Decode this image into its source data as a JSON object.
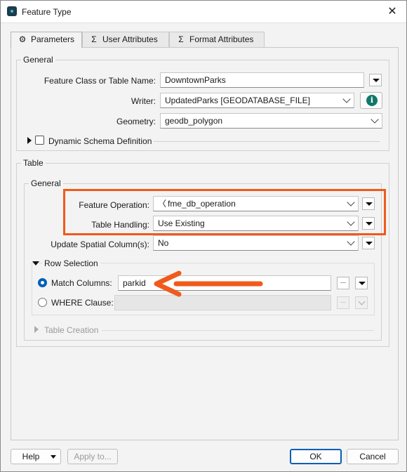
{
  "window": {
    "title": "Feature Type",
    "close_glyph": "✕"
  },
  "tabs": [
    {
      "label": "Parameters",
      "icon": "gear-icon",
      "active": true
    },
    {
      "label": "User Attributes",
      "icon": "sigma-icon",
      "active": false
    },
    {
      "label": "Format Attributes",
      "icon": "sigma-icon",
      "active": false
    }
  ],
  "general": {
    "title": "General",
    "feature_class_label": "Feature Class or Table Name:",
    "feature_class_value": "DowntownParks",
    "writer_label": "Writer:",
    "writer_value": "UpdatedParks [GEODATABASE_FILE]",
    "geometry_label": "Geometry:",
    "geometry_value": "geodb_polygon",
    "dynamic_schema_label": "Dynamic Schema Definition",
    "info_glyph": "i"
  },
  "table": {
    "title": "Table",
    "general_title": "General",
    "feature_operation_label": "Feature Operation:",
    "feature_operation_value": "fme_db_operation",
    "table_handling_label": "Table Handling:",
    "table_handling_value": "Use Existing",
    "update_spatial_label": "Update Spatial Column(s):",
    "update_spatial_value": "No",
    "row_selection_title": "Row Selection",
    "match_columns_label": "Match Columns:",
    "match_columns_value": "parkid",
    "where_clause_label": "WHERE Clause:",
    "dots_glyph": "...",
    "table_creation_title": "Table Creation"
  },
  "footer": {
    "help_label": "Help",
    "apply_label": "Apply to...",
    "ok_label": "OK",
    "cancel_label": "Cancel"
  },
  "colors": {
    "annotation": "#f05a1a",
    "accent": "#005fb8",
    "info": "#10786b"
  }
}
